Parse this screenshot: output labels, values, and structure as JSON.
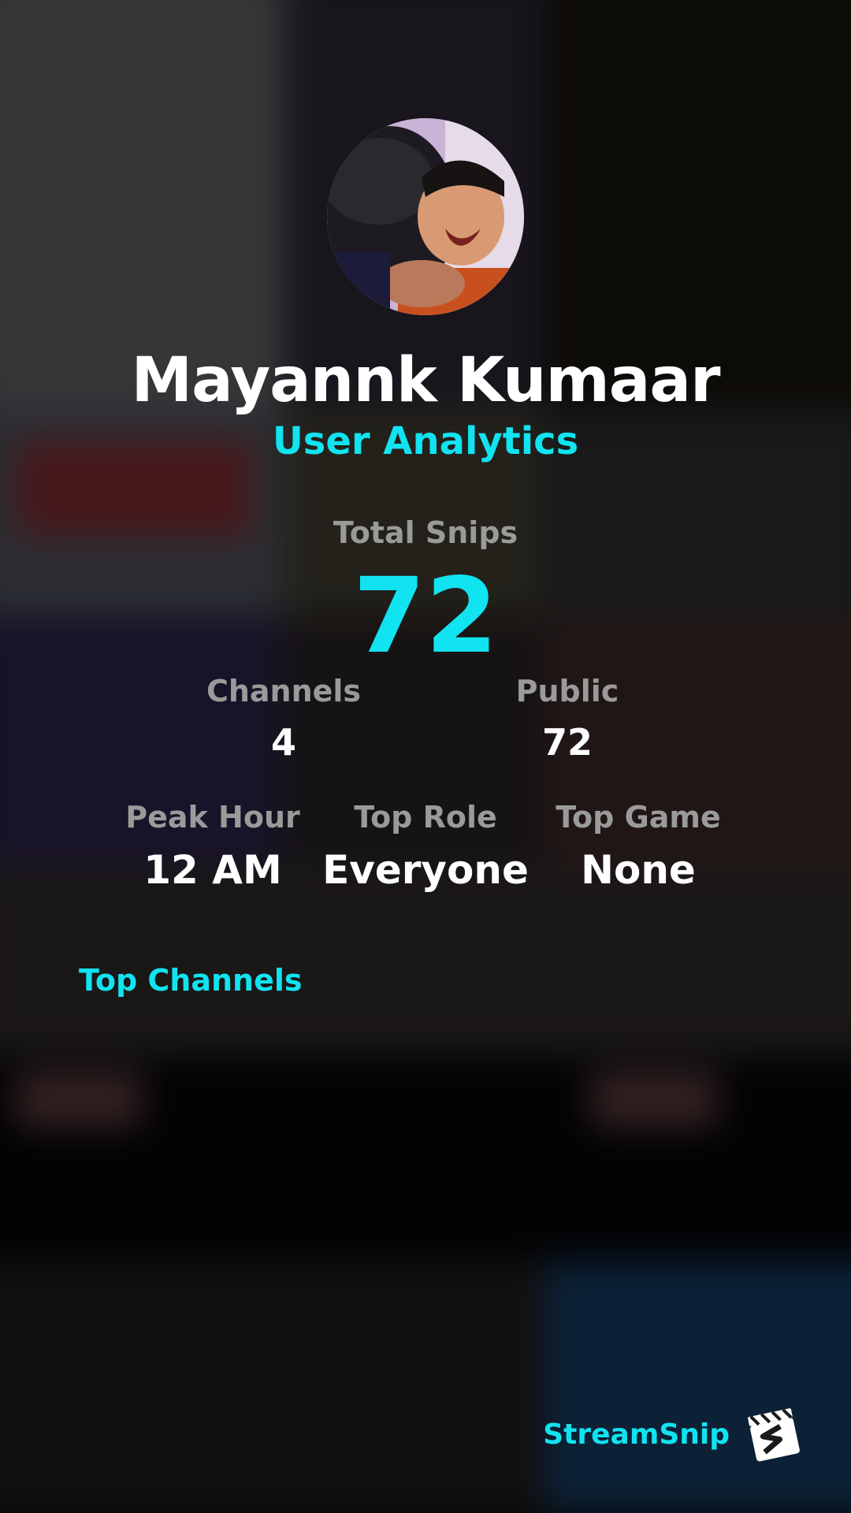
{
  "profile": {
    "name": "Mayannk Kumaar",
    "subtitle": "User Analytics"
  },
  "stats": {
    "total_snips_label": "Total Snips",
    "total_snips_value": "72",
    "channels_label": "Channels",
    "channels_value": "4",
    "public_label": "Public",
    "public_value": "72",
    "peak_hour_label": "Peak Hour",
    "peak_hour_value": "12 AM",
    "top_role_label": "Top Role",
    "top_role_value": "Everyone",
    "top_game_label": "Top Game",
    "top_game_value": "None"
  },
  "sections": {
    "top_channels_title": "Top Channels"
  },
  "brand": {
    "name": "StreamSnip",
    "logo_icon": "clapperboard-icon"
  },
  "colors": {
    "accent": "#11e3f1",
    "label": "#9a9a9a",
    "value": "#ffffff"
  }
}
